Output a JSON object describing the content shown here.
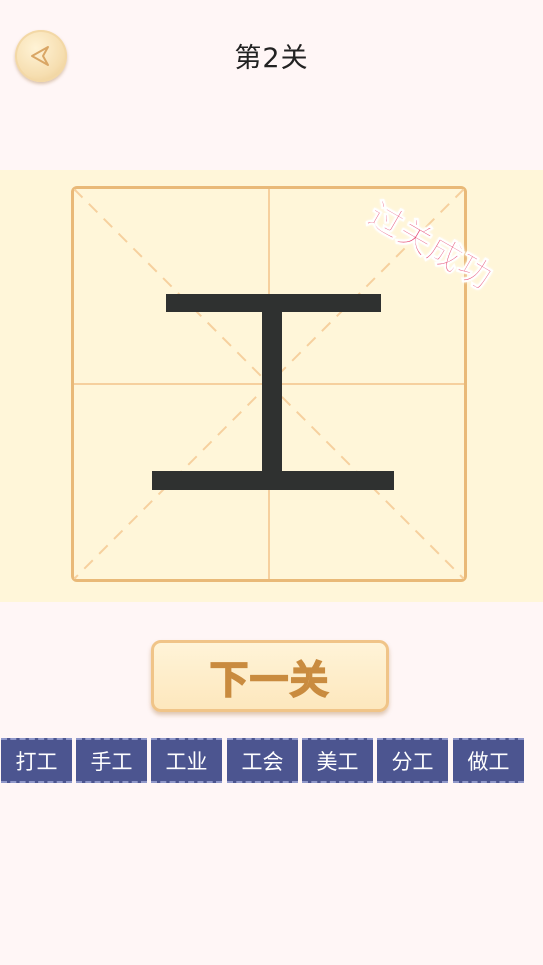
{
  "header": {
    "title": "第2关",
    "back_icon": "back-arrow-icon"
  },
  "board": {
    "character": "工",
    "success_stamp": "过关成功"
  },
  "next_button": {
    "label": "下一关"
  },
  "words": [
    "打工",
    "手工",
    "工业",
    "工会",
    "美工",
    "分工",
    "做工"
  ],
  "colors": {
    "background": "#fff6f6",
    "board_background": "#fff6d9",
    "grid_border": "#e9b978",
    "word_tile": "#4c5590",
    "stamp": "#e4456e"
  }
}
